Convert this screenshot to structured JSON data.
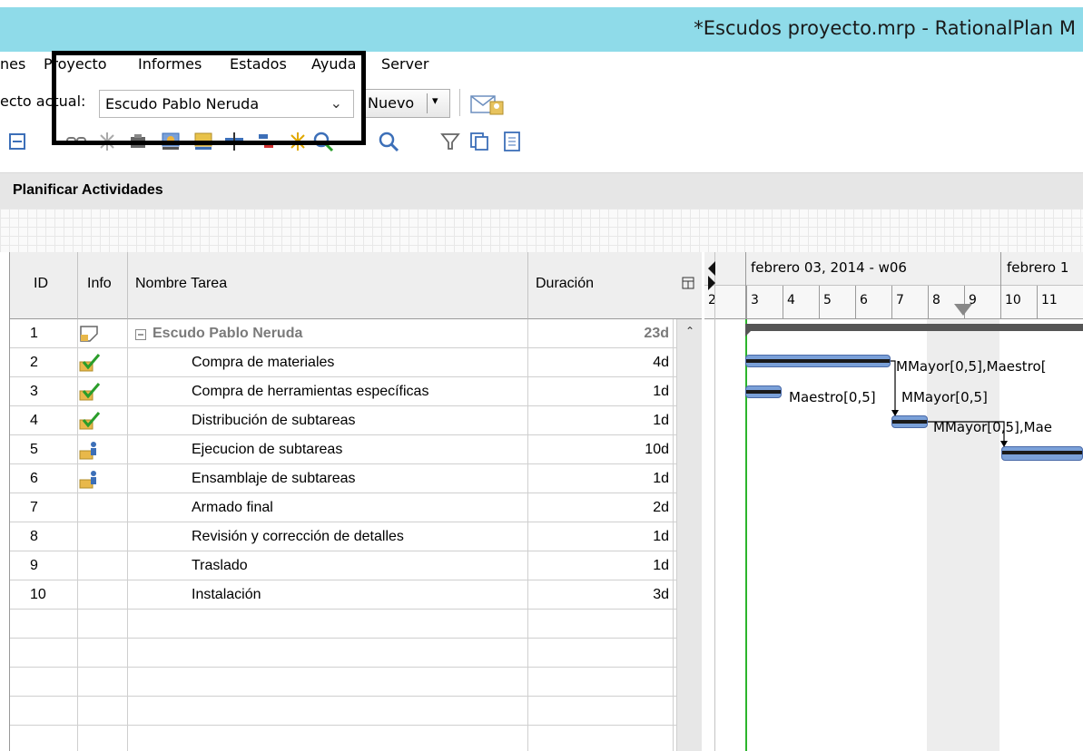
{
  "window": {
    "title": "*Escudos proyecto.mrp - RationalPlan M"
  },
  "menu": {
    "items": [
      "nes",
      "Proyecto",
      "Informes",
      "Estados",
      "Ayuda",
      "Server"
    ]
  },
  "toolbar": {
    "project_label": "ecto actual:",
    "project_selected": "Escudo Pablo Neruda",
    "new_button_label": "Nuevo",
    "dropdown_glyph": "▾"
  },
  "panel": {
    "title": "Planificar Actividades"
  },
  "table": {
    "headers": {
      "id": "ID",
      "info": "Info",
      "name": "Nombre Tarea",
      "duration": "Duración"
    },
    "rows": [
      {
        "id": "1",
        "info_icon": "note-icon",
        "name": "Escudo Pablo Neruda",
        "duration": "23d",
        "summary": true
      },
      {
        "id": "2",
        "info_icon": "check-icon",
        "name": "Compra de materiales",
        "duration": "4d"
      },
      {
        "id": "3",
        "info_icon": "check-icon",
        "name": "Compra de herramientas específicas",
        "duration": "1d"
      },
      {
        "id": "4",
        "info_icon": "check-icon",
        "name": "Distribución  de subtareas",
        "duration": "1d"
      },
      {
        "id": "5",
        "info_icon": "resource-icon",
        "name": "Ejecucion de subtareas",
        "duration": "10d"
      },
      {
        "id": "6",
        "info_icon": "resource-icon",
        "name": "Ensamblaje de subtareas",
        "duration": "1d"
      },
      {
        "id": "7",
        "info_icon": "",
        "name": "Armado final",
        "duration": "2d"
      },
      {
        "id": "8",
        "info_icon": "",
        "name": "Revisión y corrección de detalles",
        "duration": "1d"
      },
      {
        "id": "9",
        "info_icon": "",
        "name": "Traslado",
        "duration": "1d"
      },
      {
        "id": "10",
        "info_icon": "",
        "name": "Instalación",
        "duration": "3d"
      }
    ]
  },
  "gantt": {
    "weeks": [
      "febrero 03, 2014 - w06",
      "febrero 1"
    ],
    "days": [
      "2",
      "3",
      "4",
      "5",
      "6",
      "7",
      "8",
      "9",
      "10",
      "11"
    ],
    "resource_labels": [
      "MMayor[0,5],Maestro[",
      "Maestro[0,5]",
      "MMayor[0,5]",
      "MMayor[0,5],Mae"
    ]
  },
  "colors": {
    "titlebar": "#8fdbe9",
    "bar_fill": "#7aa0d8",
    "today_line": "#2cb52c"
  }
}
